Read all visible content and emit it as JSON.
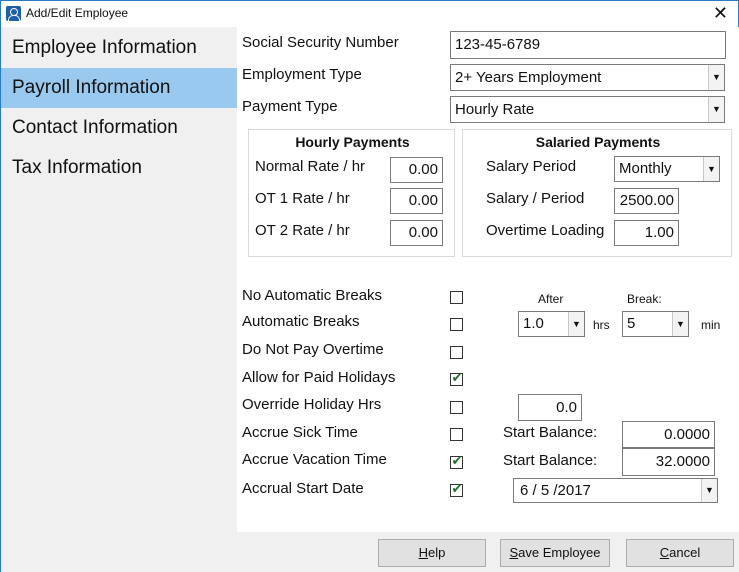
{
  "window": {
    "title": "Add/Edit Employee",
    "close_glyph": "✕",
    "icon": "user-icon"
  },
  "sidebar": {
    "items": [
      {
        "label": "Employee Information",
        "active": false
      },
      {
        "label": "Payroll Information",
        "active": true
      },
      {
        "label": "Contact Information",
        "active": false
      },
      {
        "label": "Tax Information",
        "active": false
      }
    ]
  },
  "form": {
    "ssn_label": "Social Security Number",
    "ssn_value": "123-45-6789",
    "employment_type_label": "Employment Type",
    "employment_type_value": "2+ Years Employment",
    "payment_type_label": "Payment Type",
    "payment_type_value": "Hourly Rate"
  },
  "hourly": {
    "title": "Hourly Payments",
    "normal_label": "Normal Rate / hr",
    "normal_value": "0.00",
    "ot1_label": "OT 1 Rate / hr",
    "ot1_value": "0.00",
    "ot2_label": "OT 2 Rate / hr",
    "ot2_value": "0.00"
  },
  "salaried": {
    "title": "Salaried Payments",
    "period_label": "Salary Period",
    "period_value": "Monthly",
    "per_period_label": "Salary / Period",
    "per_period_value": "2500.00",
    "overtime_label": "Overtime Loading",
    "overtime_value": "1.00"
  },
  "options": {
    "no_auto_breaks": {
      "label": "No Automatic Breaks",
      "checked": false
    },
    "auto_breaks": {
      "label": "Automatic Breaks",
      "checked": false
    },
    "no_overtime": {
      "label": "Do Not Pay Overtime",
      "checked": false
    },
    "paid_holidays": {
      "label": "Allow for Paid Holidays",
      "checked": true
    },
    "override_holiday": {
      "label": "Override Holiday Hrs",
      "checked": false
    },
    "accrue_sick": {
      "label": "Accrue Sick Time",
      "checked": false
    },
    "accrue_vacation": {
      "label": "Accrue Vacation Time",
      "checked": true
    },
    "accrual_start": {
      "label": "Accrual Start Date",
      "checked": true
    }
  },
  "breaks": {
    "after_label": "After",
    "break_label": "Break:",
    "after_value": "1.0",
    "hrs_label": "hrs",
    "break_value": "5",
    "min_label": "min"
  },
  "holiday_hrs_value": "0.0",
  "sick": {
    "start_label": "Start Balance:",
    "start_value": "0.0000"
  },
  "vacation": {
    "start_label": "Start Balance:",
    "start_value": "32.0000"
  },
  "accrual_date_value": "6 / 5 /2017",
  "buttons": {
    "help": {
      "mnemonic": "H",
      "rest": "elp"
    },
    "save": {
      "mnemonic": "S",
      "rest": "ave Employee"
    },
    "cancel": {
      "mnemonic": "C",
      "rest": "ancel"
    }
  },
  "check_glyph": "✔",
  "dropdown_glyph": "▼"
}
